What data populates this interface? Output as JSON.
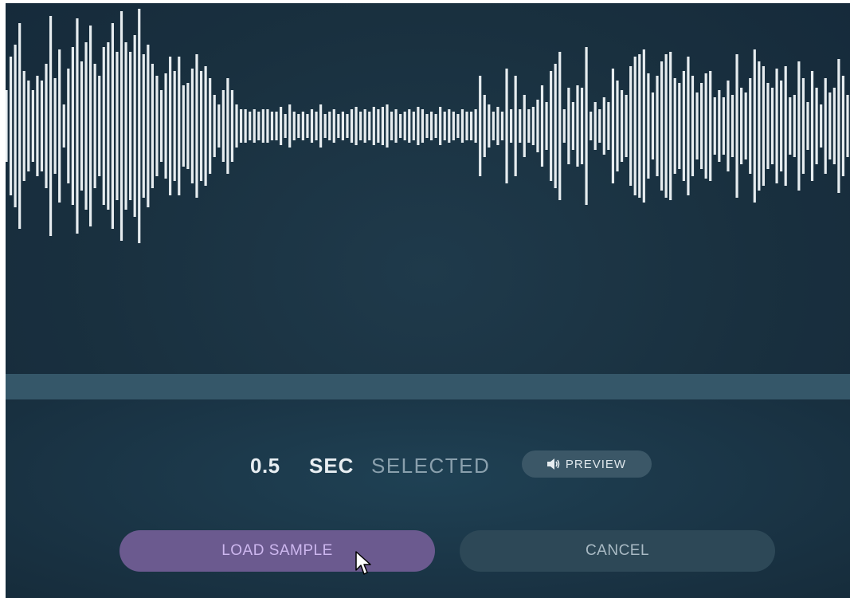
{
  "waveform": {
    "color": "#e6ecef",
    "bars": [
      0.3,
      0.58,
      0.68,
      0.86,
      0.46,
      0.38,
      0.3,
      0.42,
      0.38,
      0.52,
      0.92,
      0.4,
      0.64,
      0.18,
      0.48,
      0.66,
      0.9,
      0.54,
      0.7,
      0.84,
      0.52,
      0.42,
      0.66,
      0.7,
      0.86,
      0.62,
      0.96,
      0.7,
      0.62,
      0.76,
      0.98,
      0.6,
      0.68,
      0.52,
      0.42,
      0.3,
      0.44,
      0.58,
      0.46,
      0.58,
      0.34,
      0.36,
      0.48,
      0.6,
      0.46,
      0.5,
      0.4,
      0.26,
      0.18,
      0.3,
      0.4,
      0.3,
      0.18,
      0.14,
      0.14,
      0.12,
      0.14,
      0.12,
      0.14,
      0.14,
      0.12,
      0.12,
      0.16,
      0.1,
      0.18,
      0.12,
      0.1,
      0.12,
      0.1,
      0.14,
      0.12,
      0.18,
      0.1,
      0.12,
      0.14,
      0.1,
      0.12,
      0.1,
      0.14,
      0.16,
      0.12,
      0.14,
      0.12,
      0.16,
      0.14,
      0.16,
      0.18,
      0.12,
      0.14,
      0.1,
      0.12,
      0.14,
      0.12,
      0.16,
      0.14,
      0.1,
      0.12,
      0.1,
      0.16,
      0.12,
      0.14,
      0.12,
      0.1,
      0.14,
      0.12,
      0.12,
      0.14,
      0.42,
      0.26,
      0.18,
      0.12,
      0.16,
      0.12,
      0.48,
      0.14,
      0.42,
      0.14,
      0.26,
      0.14,
      0.16,
      0.22,
      0.34,
      0.2,
      0.46,
      0.52,
      0.62,
      0.14,
      0.32,
      0.2,
      0.34,
      0.32,
      0.66,
      0.12,
      0.2,
      0.14,
      0.24,
      0.2,
      0.48,
      0.38,
      0.3,
      0.26,
      0.5,
      0.58,
      0.6,
      0.64,
      0.44,
      0.28,
      0.42,
      0.54,
      0.6,
      0.62,
      0.4,
      0.36,
      0.46,
      0.58,
      0.42,
      0.28,
      0.36,
      0.44,
      0.46,
      0.24,
      0.3,
      0.24,
      0.38,
      0.26,
      0.6,
      0.32,
      0.28,
      0.4,
      0.64,
      0.54,
      0.5,
      0.36,
      0.32,
      0.48,
      0.38,
      0.5,
      0.24,
      0.26,
      0.54,
      0.4,
      0.2,
      0.46,
      0.32,
      0.18,
      0.4,
      0.28,
      0.32,
      0.56,
      0.42,
      0.26
    ]
  },
  "selection": {
    "duration_value": "0.5",
    "duration_unit": "SEC",
    "duration_suffix": "SELECTED"
  },
  "preview_button": {
    "icon": "speaker-icon",
    "label": "PREVIEW"
  },
  "load_button": {
    "label": "LOAD SAMPLE",
    "color": "#6b5a8f"
  },
  "cancel_button": {
    "label": "CANCEL"
  }
}
